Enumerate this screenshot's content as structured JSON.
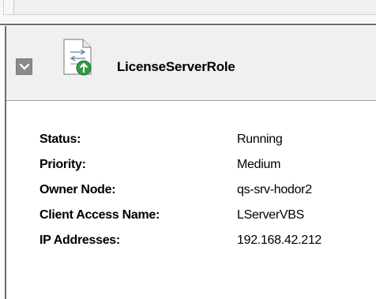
{
  "role": {
    "title": "LicenseServerRole",
    "icon": "license-server-role-icon",
    "collapse_icon": "chevron-down-icon"
  },
  "details": [
    {
      "label": "Status:",
      "value": "Running"
    },
    {
      "label": "Priority:",
      "value": "Medium"
    },
    {
      "label": "Owner Node:",
      "value": "qs-srv-hodor2"
    },
    {
      "label": "Client Access Name:",
      "value": "LServerVBS"
    },
    {
      "label": "IP Addresses:",
      "value": "192.168.42.212"
    }
  ],
  "colors": {
    "header_bg": "#f0f0f0",
    "frame": "#6d6d6d",
    "collapse_button": "#8a8a8a",
    "icon_badge": "#2e9d3f"
  }
}
